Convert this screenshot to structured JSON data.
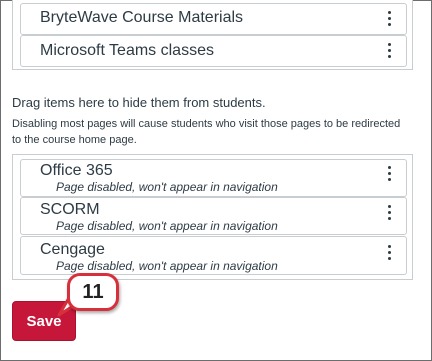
{
  "enabled_pages": [
    {
      "name": "BryteWave Course Materials"
    },
    {
      "name": "Microsoft Teams classes"
    }
  ],
  "hidden_section": {
    "title": "Drag items here to hide them from students.",
    "description": "Disabling most pages will cause students who visit those pages to be redirected to the course home page."
  },
  "disabled_pages": [
    {
      "name": "Office 365",
      "status": "Page disabled, won't appear in navigation"
    },
    {
      "name": "SCORM",
      "status": "Page disabled, won't appear in navigation"
    },
    {
      "name": "Cengage",
      "status": "Page disabled, won't appear in navigation"
    }
  ],
  "save_label": "Save",
  "step_badge": "11",
  "colors": {
    "save_button": "#c6163a",
    "callout_border": "#d6303c",
    "text": "#2d3b45",
    "border": "#c7cdd1"
  }
}
